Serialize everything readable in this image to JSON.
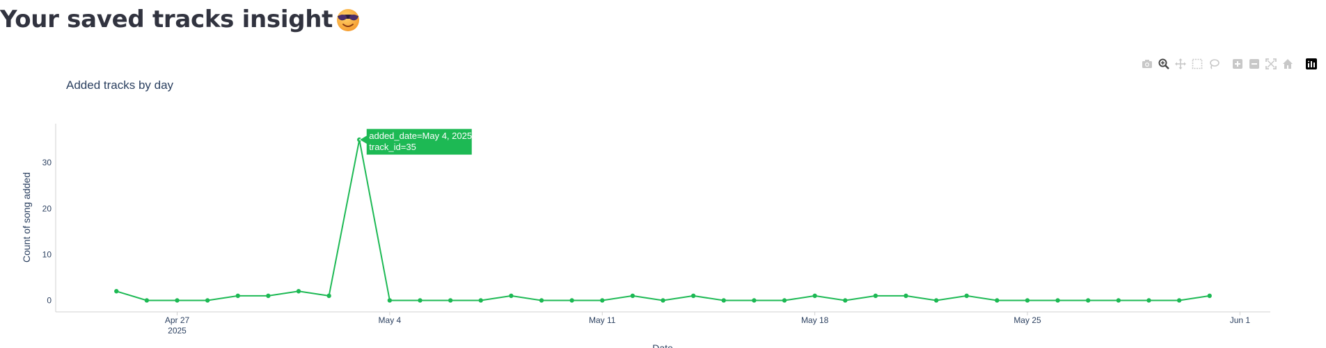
{
  "page": {
    "title": "Your saved tracks insight",
    "title_emoji": "smiling-face-with-sunglasses-icon"
  },
  "modebar": {
    "buttons": [
      "camera-icon",
      "zoom-icon",
      "pan-icon",
      "box-select-icon",
      "lasso-select-icon",
      "zoom-in-icon",
      "zoom-out-icon",
      "autoscale-icon",
      "reset-axes-icon",
      "plotly-logo-icon"
    ]
  },
  "colors": {
    "line": "#1DB954",
    "title_text": "#31333f",
    "axis_text": "#2a3f5f",
    "modebar_icon": "#c8c8c8",
    "modebar_active": "#444444"
  },
  "chart_data": {
    "type": "line",
    "title": "Added tracks by day",
    "xlabel": "Date",
    "ylabel": "Count of song added",
    "x_ticks": [
      {
        "date": "2025-04-27",
        "label": "Apr 27",
        "sublabel": "2025"
      },
      {
        "date": "2025-05-04",
        "label": "May 4"
      },
      {
        "date": "2025-05-11",
        "label": "May 11"
      },
      {
        "date": "2025-05-18",
        "label": "May 18"
      },
      {
        "date": "2025-05-25",
        "label": "May 25"
      },
      {
        "date": "2025-06-01",
        "label": "Jun 1"
      }
    ],
    "y_ticks": [
      0,
      10,
      20,
      30
    ],
    "xlim": [
      "2025-04-23",
      "2025-06-02"
    ],
    "ylim": [
      -2.5,
      38.5
    ],
    "grid": false,
    "series": [
      {
        "x": [
          "2025-04-25",
          "2025-04-26",
          "2025-04-27",
          "2025-04-28",
          "2025-04-29",
          "2025-04-30",
          "2025-05-01",
          "2025-05-02",
          "2025-05-03",
          "2025-05-04",
          "2025-05-05",
          "2025-05-06",
          "2025-05-07",
          "2025-05-08",
          "2025-05-09",
          "2025-05-10",
          "2025-05-11",
          "2025-05-12",
          "2025-05-13",
          "2025-05-14",
          "2025-05-15",
          "2025-05-16",
          "2025-05-17",
          "2025-05-18",
          "2025-05-19",
          "2025-05-20",
          "2025-05-21",
          "2025-05-22",
          "2025-05-23",
          "2025-05-24",
          "2025-05-25",
          "2025-05-26",
          "2025-05-27",
          "2025-05-28",
          "2025-05-29",
          "2025-05-30",
          "2025-05-31"
        ],
        "y": [
          2,
          0,
          0,
          0,
          1,
          1,
          2,
          1,
          35,
          0,
          0,
          0,
          0,
          1,
          0,
          0,
          0,
          1,
          0,
          1,
          0,
          0,
          0,
          1,
          0,
          1,
          1,
          0,
          1,
          0,
          0,
          0,
          0,
          0,
          0,
          0,
          1
        ]
      }
    ],
    "hover": {
      "date": "2025-05-03",
      "lines": [
        "added_date=May 4, 2025",
        "track_id=35"
      ]
    }
  }
}
